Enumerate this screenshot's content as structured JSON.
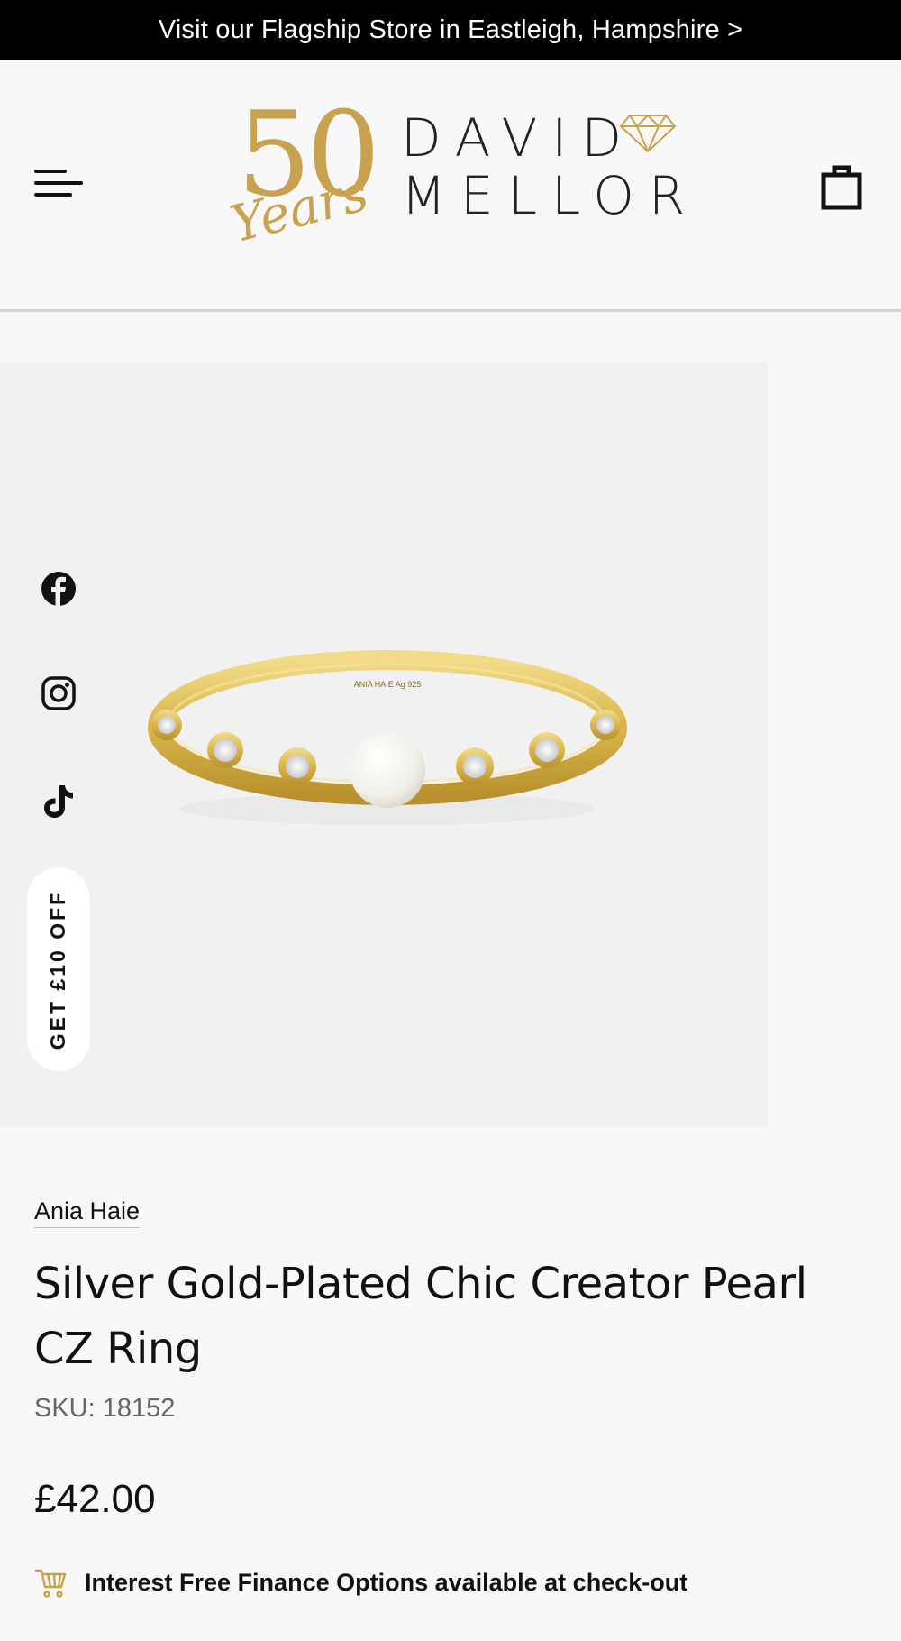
{
  "announcement": {
    "text": "Visit our Flagship Store in Eastleigh, Hampshire >"
  },
  "logo": {
    "anniversary_number": "50",
    "anniversary_word": "Years",
    "brand_line1": "DAVID",
    "brand_line2": "MELLOR"
  },
  "icons": {
    "menu": "hamburger-menu-icon",
    "cart": "shopping-bag-icon",
    "facebook": "facebook-icon",
    "instagram": "instagram-icon",
    "tiktok": "tiktok-icon",
    "finance": "shopping-cart-icon",
    "logo_diamond": "diamond-icon"
  },
  "colors": {
    "gold": "#c8a24e",
    "announcement_bg": "#000000",
    "page_bg": "#f8f8f8"
  },
  "promo": {
    "label": "GET £10 OFF"
  },
  "product": {
    "brand": "Ania Haie",
    "title": "Silver Gold-Plated Chic Creator Pearl CZ Ring",
    "sku": "SKU: 18152",
    "price": "£42.00",
    "finance_text": "Interest Free Finance Options available at check-out",
    "engraving": "ANIA HAIE Ag 925"
  }
}
